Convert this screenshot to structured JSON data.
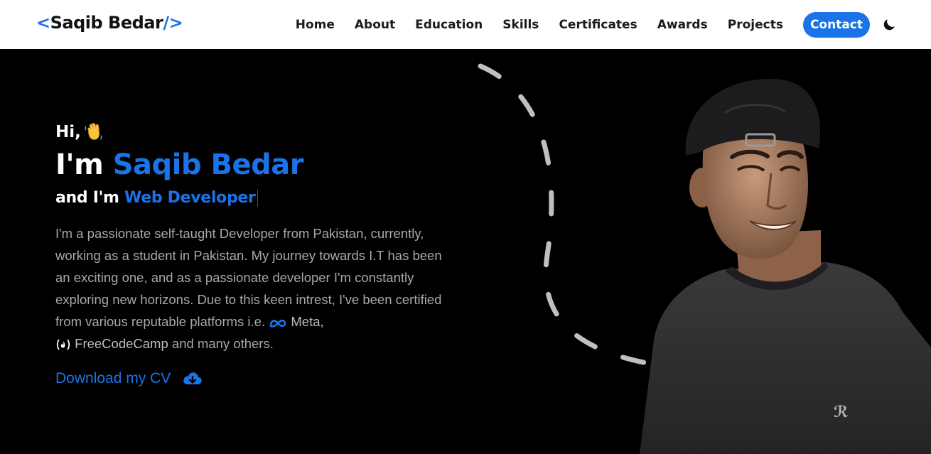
{
  "navbar": {
    "logo": {
      "open": "<",
      "name": "Saqib Bedar",
      "close": "/>"
    },
    "links": [
      "Home",
      "About",
      "Education",
      "Skills",
      "Certificates",
      "Awards",
      "Projects"
    ],
    "contact": "Contact",
    "theme_icon": "moon-icon"
  },
  "hero": {
    "greeting": "Hi,",
    "wave_icon": "waving-hand-icon",
    "name_prefix": "I'm",
    "name": "Saqib Bedar",
    "role_prefix": "and I'm",
    "role": "Web Developer",
    "bio_part1": "I'm a passionate self-taught Developer from Pakistan, currently, working as a student in Pakistan. My journey towards I.T has been an exciting one, and as a passionate developer I'm constantly exploring new horizons. Due to this keen intrest, I've been certified from various reputable platforms i.e.",
    "brand1": "Meta,",
    "brand2": "FreeCodeCamp",
    "bio_part2": "and many others.",
    "cv_label": "Download my CV",
    "cv_icon": "cloud-download-icon"
  },
  "colors": {
    "accent": "#1a73e8",
    "background": "#000000",
    "nav_bg": "#ffffff"
  }
}
